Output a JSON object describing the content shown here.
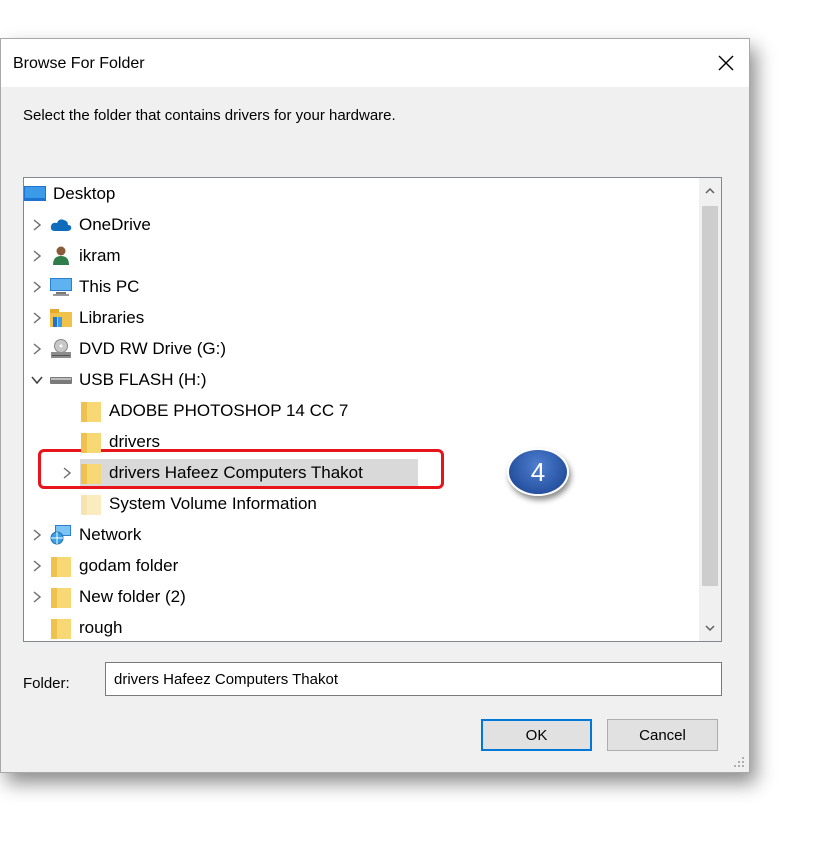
{
  "dialog": {
    "title": "Browse For Folder",
    "instruction": "Select the folder that contains drivers for your hardware."
  },
  "tree": {
    "items": [
      {
        "label": "Desktop",
        "icon": "desktop-icon",
        "expander": "none",
        "level": 0
      },
      {
        "label": "OneDrive",
        "icon": "cloud-icon",
        "expander": "collapsed",
        "level": 1
      },
      {
        "label": "ikram",
        "icon": "user-icon",
        "expander": "collapsed",
        "level": 1
      },
      {
        "label": "This PC",
        "icon": "computer-icon",
        "expander": "collapsed",
        "level": 1
      },
      {
        "label": "Libraries",
        "icon": "libraries-icon",
        "expander": "collapsed",
        "level": 1
      },
      {
        "label": "DVD RW Drive (G:)",
        "icon": "dvd-drive-icon",
        "expander": "collapsed",
        "level": 1
      },
      {
        "label": "USB FLASH (H:)",
        "icon": "usb-drive-icon",
        "expander": "expanded",
        "level": 1
      },
      {
        "label": "ADOBE PHOTOSHOP 14 CC 7",
        "icon": "folder-icon",
        "expander": "none",
        "level": 2
      },
      {
        "label": "drivers",
        "icon": "folder-icon",
        "expander": "none",
        "level": 2
      },
      {
        "label": "drivers Hafeez Computers Thakot",
        "icon": "folder-icon",
        "expander": "collapsed",
        "level": 2,
        "selected": true
      },
      {
        "label": "System Volume Information",
        "icon": "folder-icon",
        "expander": "none",
        "level": 2
      },
      {
        "label": "Network",
        "icon": "network-icon",
        "expander": "collapsed",
        "level": 1
      },
      {
        "label": "godam folder",
        "icon": "folder-icon",
        "expander": "collapsed",
        "level": 1
      },
      {
        "label": "New folder (2)",
        "icon": "folder-icon",
        "expander": "collapsed",
        "level": 1
      },
      {
        "label": "rough",
        "icon": "folder-icon",
        "expander": "none",
        "level": 1
      }
    ]
  },
  "annotation": {
    "step_number": "4",
    "color": "#e8141c"
  },
  "folder": {
    "label": "Folder:",
    "value": "drivers Hafeez Computers Thakot"
  },
  "buttons": {
    "ok": "OK",
    "cancel": "Cancel"
  },
  "colors": {
    "accent": "#0078d7",
    "selection": "#d9d9d9",
    "badge": "#2e5caf"
  }
}
